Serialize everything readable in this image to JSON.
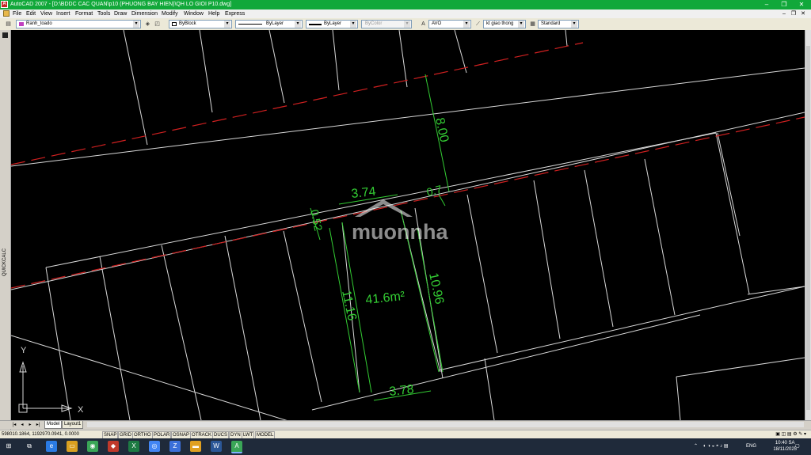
{
  "window": {
    "title": "AutoCAD 2007 - [D:\\BDDC CAC QUAN\\p10 (PHUONG BAY HIEN)\\QH LO GIOI P10.dwg]",
    "minimize": "–",
    "restore": "❐",
    "close": "✕"
  },
  "menu": {
    "items": [
      "File",
      "Edit",
      "View",
      "Insert",
      "Format",
      "Tools",
      "Draw",
      "Dimension",
      "Modify",
      "Window",
      "Help",
      "Express"
    ],
    "mdi_minimize": "–",
    "mdi_restore": "❐",
    "mdi_close": "✕"
  },
  "toolbar": {
    "layer": "Ranh_toado",
    "color": "ByBlock",
    "linetype": "ByLayer",
    "lineweight": "ByLayer",
    "plotstyle": "ByColor",
    "textstyle": "AVO",
    "dimstyle": "kt giao thong",
    "tablestyle": "Standard",
    "arrow": "▾"
  },
  "sidebar": {
    "label": "QUICKCALC"
  },
  "drawing": {
    "dim_top_width": "3.74",
    "dim_top_right": "0.7",
    "dim_left_offset": "0.52",
    "dim_road": "8.00",
    "dim_left_depth": "11.16",
    "dim_right_depth": "10.96",
    "area": "41.6m²",
    "dim_bottom_width": "3.78",
    "watermark": "muonnha",
    "ucs_y": "Y",
    "ucs_x": "X",
    "colors": {
      "dimension": "#33cc33",
      "boundary": "#d9d9d9",
      "road_centerline": "#d02020",
      "watermark": "#ffffff"
    }
  },
  "tabs": {
    "items": [
      "Model",
      "Layout1"
    ],
    "nav": [
      "|◂",
      "◂",
      "▸",
      "▸|"
    ]
  },
  "status": {
    "coordinates": "598010.1864, 1192970.0941, 0.0000",
    "toggles": [
      "SNAP",
      "GRID",
      "ORTHO",
      "POLAR",
      "OSNAP",
      "OTRACK",
      "DUCS",
      "DYN",
      "LWT",
      "MODEL"
    ]
  },
  "taskbar": {
    "language": "ENG",
    "time": "10:40 SA",
    "date": "18/11/2025"
  }
}
